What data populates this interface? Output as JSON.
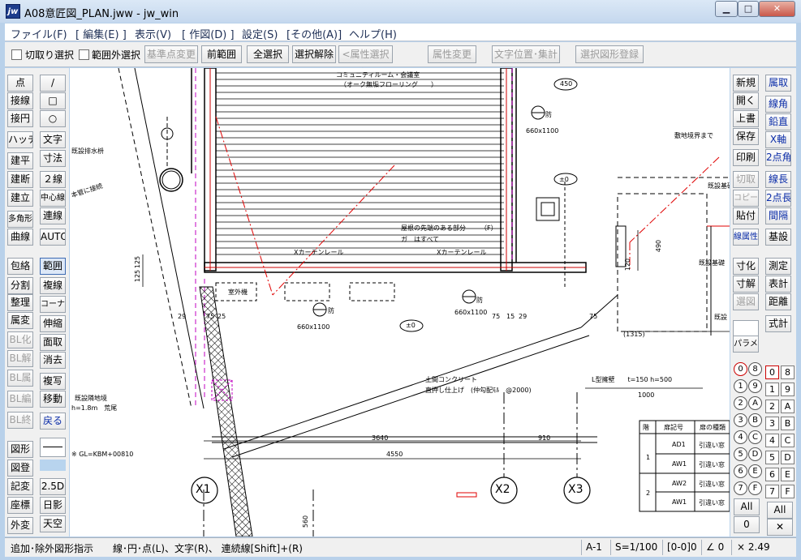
{
  "window": {
    "title": "A08意匠図_PLAN.jww - jw_win",
    "app_icon": "jw",
    "controls": [
      "minimize",
      "maximize",
      "close"
    ]
  },
  "menu": [
    "ファイル(F)",
    "[ 編集(E) ]",
    "表示(V)",
    "[ 作図(D) ]",
    "設定(S)",
    "[その他(A)]",
    "ヘルプ(H)"
  ],
  "toolbar": {
    "check1_label": "切取り選択",
    "check2_label": "範囲外選択",
    "buttons": [
      {
        "label": "基準点変更",
        "enabled": false
      },
      {
        "label": "前範囲",
        "enabled": true
      },
      {
        "label": "全選択",
        "enabled": true
      },
      {
        "label": "選択解除",
        "enabled": true
      },
      {
        "label": "<属性選択>",
        "enabled": false
      },
      {
        "label": "属性変更",
        "enabled": false
      },
      {
        "label": "文字位置･集計",
        "enabled": false
      },
      {
        "label": "選択図形登録",
        "enabled": false
      }
    ]
  },
  "left_tools": {
    "col1": [
      "点",
      "接線",
      "接円",
      "ハッチ",
      "建平",
      "建断",
      "建立",
      "多角形",
      "曲線",
      "包絡",
      "分割",
      "整理",
      "属変",
      "BL化",
      "BL解",
      "BL属",
      "BL編",
      "BL終",
      "図形",
      "図登",
      "記変",
      "座標",
      "外変"
    ],
    "col1_disabled": [
      "BL化",
      "BL解",
      "BL属",
      "BL編",
      "BL終"
    ],
    "col2": [
      "/",
      "□",
      "○",
      "文字",
      "寸法",
      "２線",
      "中心線",
      "連線",
      "AUTO",
      "範囲",
      "複線",
      "コーナー",
      "伸縮",
      "面取",
      "消去",
      "複写",
      "移動",
      "戻る",
      "2.5D",
      "日影",
      "天空"
    ],
    "col2_blue": [
      "戻る"
    ]
  },
  "right_tools": {
    "col1": [
      "新規",
      "開く",
      "上書",
      "保存",
      "印刷",
      "切取",
      "コピー",
      "貼付",
      "線属性",
      "寸化",
      "寸解",
      "選図",
      "パラメ"
    ],
    "col1_disabled": [
      "切取",
      "コピー",
      "選図"
    ],
    "col2": [
      "属取",
      "線角",
      "鉛直",
      "X軸",
      "2点角",
      "線長",
      "2点長",
      "間隔",
      "基設",
      "測定",
      "表計",
      "距離",
      "式計"
    ],
    "col2_blue": [
      "属取",
      "線角",
      "鉛直",
      "X軸",
      "2点角",
      "線長",
      "2点長",
      "間隔"
    ],
    "layer_group_circles": [
      "0",
      "1",
      "2",
      "3",
      "4",
      "5",
      "6",
      "7",
      "8",
      "9",
      "A",
      "B",
      "C",
      "D",
      "E",
      "F"
    ],
    "layer_boxes": [
      "0",
      "1",
      "2",
      "3",
      "4",
      "5",
      "6",
      "7",
      "8",
      "9",
      "A",
      "B",
      "C",
      "D",
      "E",
      "F"
    ],
    "all_label": "All",
    "zero_label": "0"
  },
  "drawing": {
    "texts": [
      "コミュニティルーム・会議室",
      "（オーク無垢フローリング　　）",
      "既設排水枡",
      "本管に接続",
      "既設基礎",
      "敷地境界まで",
      "屋根の先端のある部分",
      "（F）",
      "ガ　はすべて",
      "Xカーテンレール",
      "Xカーテンレール",
      "室外機",
      "660x1100",
      "660x1100",
      "660x1100",
      "防",
      "防",
      "防",
      "±0",
      "±0",
      "土間コンクリート",
      "直押し仕上げ　(仲勾配ﾓﾙ　@2000)",
      "既設隣地境",
      "h=1.8m　荒尾",
      "L型擁壁　　t=150 h=500",
      "1000",
      "(1315)",
      "3640",
      "910",
      "4550",
      "※ GL=KBM+00810",
      "既設基礎",
      "既設",
      "450",
      "490",
      "125",
      "125",
      "120",
      "75",
      "75",
      "29",
      "15",
      "29",
      "75",
      "25",
      "560"
    ],
    "grid_labels": [
      "X1",
      "X2",
      "X3"
    ],
    "door_table": {
      "headers": [
        "階",
        "扉記号",
        "扉の種類"
      ],
      "rows": [
        {
          "floor": "1",
          "code": "AD1",
          "type": "引違い窓"
        },
        {
          "floor": "",
          "code": "AW1",
          "type": "引違い窓"
        },
        {
          "floor": "2",
          "code": "AW2",
          "type": "引違い窓"
        },
        {
          "floor": "",
          "code": "AW1",
          "type": "引違い窓"
        }
      ]
    }
  },
  "status": {
    "message": "追加･除外図形指示　　線･円･点(L)、文字(R)、 連続線[Shift]+(R)",
    "paper": "A-1",
    "scale": "S=1/100",
    "layer": "[0-0]0",
    "angle": "∠ 0",
    "zoom": "× 2.49"
  },
  "colors": {
    "hatch_red": "#cc0000",
    "dash_magenta": "#c000c0",
    "dash_red": "#e00000",
    "ui_blue_text": "#0a2ca8"
  }
}
